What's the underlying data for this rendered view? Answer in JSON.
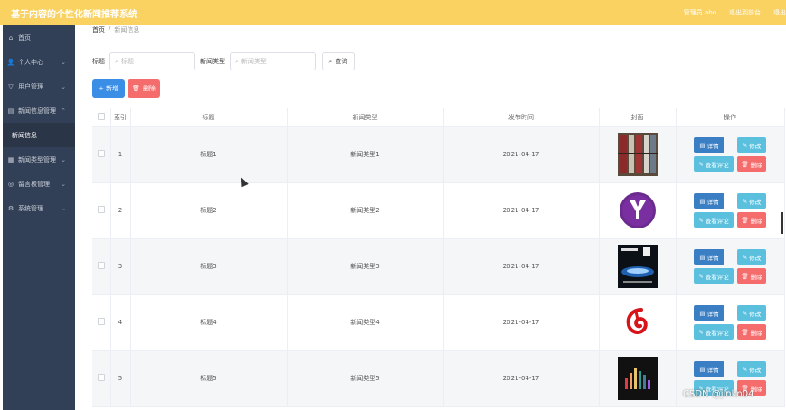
{
  "app": {
    "title": "基于内容的个性化新闻推荐系统",
    "top_links": [
      "管理员 abo",
      "退出到前台",
      "退出"
    ]
  },
  "sidebar": {
    "items": [
      {
        "label": "首页",
        "icon": "home-icon",
        "chevron": false
      },
      {
        "label": "个人中心",
        "icon": "user-icon",
        "chevron": true
      },
      {
        "label": "用户管理",
        "icon": "filter-icon",
        "chevron": true
      },
      {
        "label": "新闻信息管理",
        "icon": "doc-icon",
        "chevron": true
      },
      {
        "label": "新闻信息",
        "icon": "",
        "chevron": false,
        "sub": true
      },
      {
        "label": "新闻类型管理",
        "icon": "list-icon",
        "chevron": true
      },
      {
        "label": "留言板管理",
        "icon": "comment-icon",
        "chevron": true
      },
      {
        "label": "系统管理",
        "icon": "gear-icon",
        "chevron": true
      }
    ]
  },
  "breadcrumb": {
    "home": "首页",
    "sep": "/",
    "current": "新闻信息"
  },
  "search": {
    "title_label": "标题",
    "title_placeholder": "标题",
    "type_label": "新闻类型",
    "type_placeholder": "新闻类型",
    "query_button": "查询"
  },
  "actions": {
    "add": "+ 新增",
    "delete": "删除"
  },
  "table": {
    "headers": [
      "",
      "索引",
      "标题",
      "新闻类型",
      "发布时间",
      "封面",
      "操作"
    ],
    "rows": [
      {
        "index": "1",
        "title": "标题1",
        "type": "新闻类型1",
        "date": "2021-04-17",
        "cover": "bookshelf"
      },
      {
        "index": "2",
        "title": "标题2",
        "type": "新闻类型2",
        "date": "2021-04-17",
        "cover": "yahoo"
      },
      {
        "index": "3",
        "title": "标题3",
        "type": "新闻类型3",
        "date": "2021-04-17",
        "cover": "win8"
      },
      {
        "index": "4",
        "title": "标题4",
        "type": "新闻类型4",
        "date": "2021-04-17",
        "cover": "netease-music"
      },
      {
        "index": "5",
        "title": "标题5",
        "type": "新闻类型5",
        "date": "2021-04-17",
        "cover": "equalizer"
      }
    ],
    "op_labels": {
      "detail": "详情",
      "edit": "修改",
      "comments": "查看评论",
      "remove": "删除"
    }
  },
  "watermark": "CSDN @jinkn04",
  "colors": {
    "topbar": "#f9d262",
    "sidebar": "#324057",
    "primary": "#3a8ee6",
    "danger": "#f56c6c",
    "info": "#5bc0de"
  }
}
